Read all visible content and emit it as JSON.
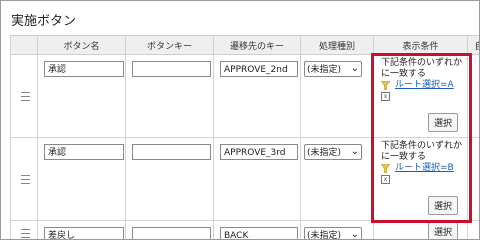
{
  "section_title": "実施ボタン",
  "columns": [
    "ボタン名",
    "ボタンキー",
    "遷移先のキー",
    "処理種別",
    "表示条件",
    "自"
  ],
  "rows": [
    {
      "name": "承認",
      "key": "",
      "dest": "APPROVE_2nd",
      "type": "(未指定)",
      "cond_line1": "下記条件のいずれか",
      "cond_line2": "に一致する",
      "route": "ルート選択=A",
      "remove": "x",
      "select": "選択"
    },
    {
      "name": "承認",
      "key": "",
      "dest": "APPROVE_3rd",
      "type": "(未指定)",
      "cond_line1": "下記条件のいずれか",
      "cond_line2": "に一致する",
      "route": "ルート選択=B",
      "remove": "x",
      "select": "選択"
    },
    {
      "name": "差戻し",
      "key": "",
      "dest": "BACK",
      "type": "(未指定)",
      "select": "選択"
    }
  ],
  "icons": {
    "drag": "drag-handle-icon",
    "filter": "funnel-icon",
    "remove": "remove-icon",
    "dropdown": "chevron-down-icon"
  },
  "colors": {
    "highlight": "#c8102e",
    "link": "#1a5fb4"
  }
}
